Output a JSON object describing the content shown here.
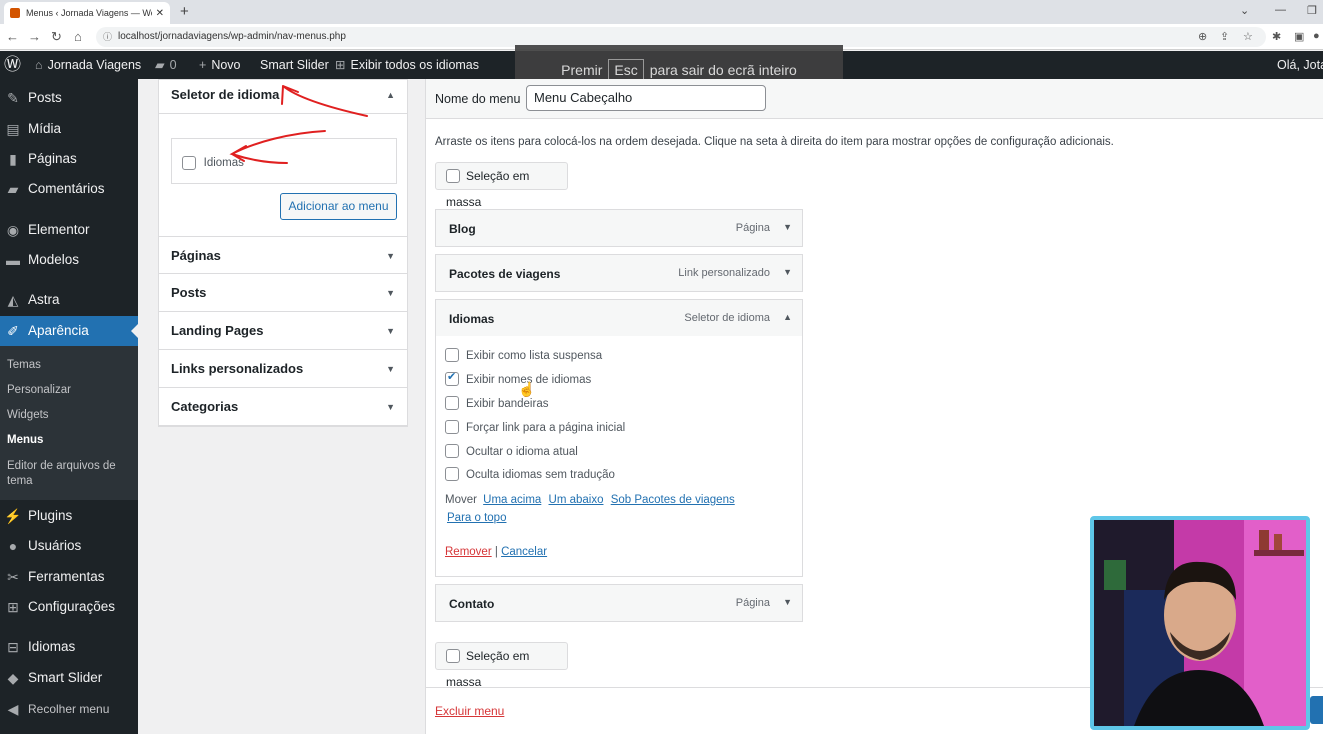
{
  "browser": {
    "tab_title": "Menus ‹ Jornada Viagens — Wor",
    "tab_close": "✕",
    "new_tab": "+",
    "url": "localhost/jornadaviagens/wp-admin/nav-menus.php"
  },
  "adminbar": {
    "site_name": "Jornada Viagens",
    "comments_count": "0",
    "new_label": "Novo",
    "smart_slider": "Smart Slider",
    "show_languages": "Exibir todos os idiomas",
    "greeting": "Olá, Jota"
  },
  "fullscreen_msg": {
    "press": "Premir",
    "key": "Esc",
    "rest": "para sair do ecrã inteiro"
  },
  "sidebar": {
    "items": [
      {
        "label": "Posts",
        "icon": "pin-icon"
      },
      {
        "label": "Mídia",
        "icon": "media-icon"
      },
      {
        "label": "Páginas",
        "icon": "page-icon"
      },
      {
        "label": "Comentários",
        "icon": "comment-icon"
      },
      {
        "label": "Elementor",
        "icon": "elementor-icon"
      },
      {
        "label": "Modelos",
        "icon": "folder-icon"
      },
      {
        "label": "Astra",
        "icon": "astra-icon"
      },
      {
        "label": "Aparência",
        "icon": "brush-icon"
      },
      {
        "label": "Plugins",
        "icon": "plugin-icon"
      },
      {
        "label": "Usuários",
        "icon": "user-icon"
      },
      {
        "label": "Ferramentas",
        "icon": "wrench-icon"
      },
      {
        "label": "Configurações",
        "icon": "settings-icon"
      },
      {
        "label": "Idiomas",
        "icon": "translate-icon"
      },
      {
        "label": "Smart Slider",
        "icon": "slider-icon"
      },
      {
        "label": "Recolher menu",
        "icon": "collapse-icon"
      }
    ],
    "submenu": [
      "Temas",
      "Personalizar",
      "Widgets",
      "Menus",
      "Editor de arquivos de tema"
    ]
  },
  "leftpanel": {
    "selector_title": "Seletor de idioma",
    "languages_label": "Idiomas",
    "add_button": "Adicionar ao menu",
    "sections": [
      "Páginas",
      "Posts",
      "Landing Pages",
      "Links personalizados",
      "Categorias"
    ]
  },
  "main": {
    "name_label": "Nome do menu",
    "name_value": "Menu Cabeçalho",
    "instructions": "Arraste os itens para colocá-los na ordem desejada. Clique na seta à direita do item para mostrar opções de configuração adicionais.",
    "bulk_select": "Seleção em massa",
    "items": [
      {
        "title": "Blog",
        "type": "Página"
      },
      {
        "title": "Pacotes de viagens",
        "type": "Link personalizado"
      },
      {
        "title": "Idiomas",
        "type": "Seletor de idioma"
      },
      {
        "title": "Contato",
        "type": "Página"
      }
    ],
    "options": [
      {
        "label": "Exibir como lista suspensa",
        "checked": false
      },
      {
        "label": "Exibir nomes de idiomas",
        "checked": true
      },
      {
        "label": "Exibir bandeiras",
        "checked": false
      },
      {
        "label": "Forçar link para a página inicial",
        "checked": false
      },
      {
        "label": "Ocultar o idioma atual",
        "checked": false
      },
      {
        "label": "Oculta idiomas sem tradução",
        "checked": false
      }
    ],
    "move_label": "Mover",
    "move_up": "Uma acima",
    "move_down": "Um abaixo",
    "move_under": "Sob Pacotes de viagens",
    "move_top": "Para o topo",
    "remove": "Remover",
    "separator": "|",
    "cancel": "Cancelar",
    "delete_menu": "Excluir menu"
  },
  "colors": {
    "admin_dark": "#1d2327",
    "accent": "#2271b1",
    "annotation_red": "#e02020",
    "webcam_border": "#5ec6e8"
  }
}
